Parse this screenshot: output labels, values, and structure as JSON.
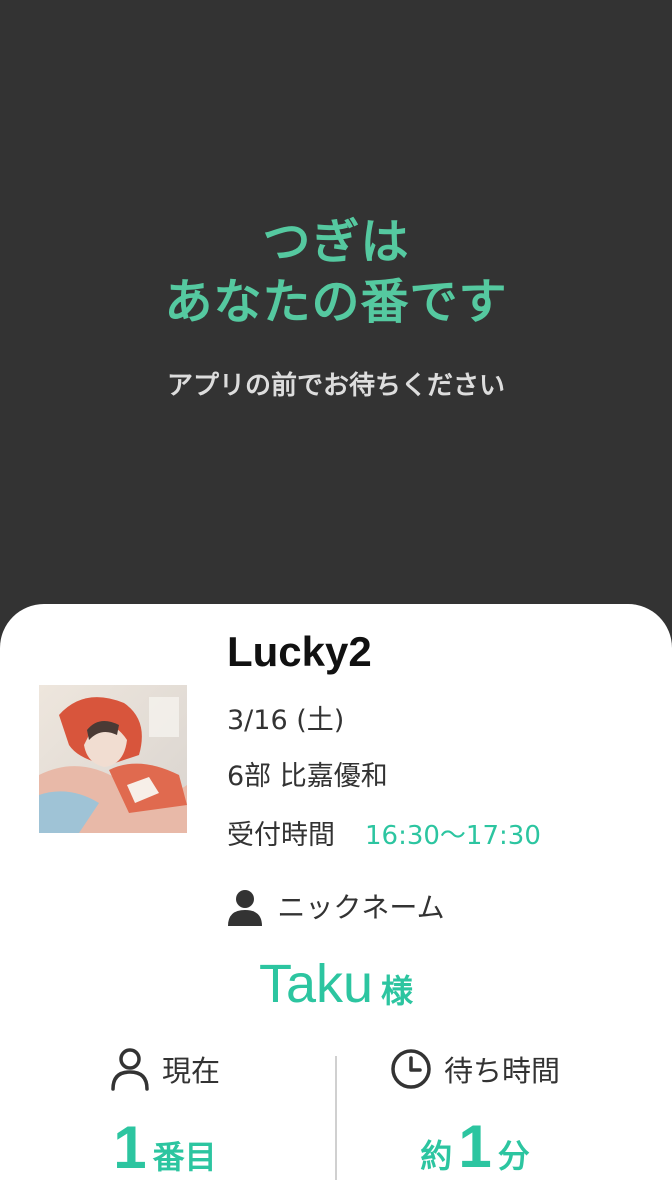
{
  "hero": {
    "title_line1": "つぎは",
    "title_line2": "あなたの番です",
    "subtitle": "アプリの前でお待ちください"
  },
  "event": {
    "name": "Lucky2",
    "date": "3/16 (土)",
    "part": "6部 比嘉優和",
    "reception_label": "受付時間",
    "reception_time": "16:30〜17:30"
  },
  "nickname": {
    "label": "ニックネーム",
    "icon": "person-icon",
    "value": "Taku",
    "suffix": "様"
  },
  "status": {
    "current": {
      "icon": "person-outline-icon",
      "label": "現在",
      "number": "1",
      "unit": "番目"
    },
    "wait": {
      "icon": "clock-icon",
      "label": "待ち時間",
      "prefix": "約",
      "number": "1",
      "unit": "分"
    }
  },
  "colors": {
    "accent": "#2cc5a0",
    "background": "#333333",
    "card": "#ffffff"
  }
}
